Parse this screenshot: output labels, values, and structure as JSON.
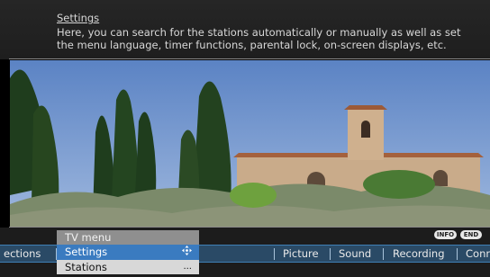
{
  "help": {
    "title": "Settings",
    "text": "Here, you can search for the stations automatically or manually as well as set the menu language, timer functions, parental lock, on-screen displays, etc."
  },
  "scene": {
    "icon": "landscape-photo"
  },
  "keys": {
    "info": "INFO",
    "end": "END"
  },
  "nav": {
    "tabs": [
      {
        "label": "ections"
      },
      {
        "label": "Picture"
      },
      {
        "label": "Sound"
      },
      {
        "label": "Recording"
      },
      {
        "label": "Conn"
      }
    ],
    "active_color": "#3a7bc0"
  },
  "menu": {
    "header": "TV menu",
    "items": [
      {
        "label": "Settings",
        "icon": "navigate-cross-icon",
        "selected": true
      },
      {
        "label": "Stations",
        "extra": "...",
        "selected": false
      }
    ]
  }
}
